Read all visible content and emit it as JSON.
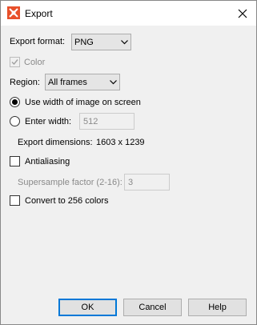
{
  "window": {
    "title": "Export",
    "close_glyph": "✕"
  },
  "export_format": {
    "label": "Export format:",
    "value": "PNG"
  },
  "color": {
    "label": "Color",
    "checked": true,
    "enabled": false
  },
  "region": {
    "label": "Region:",
    "value": "All frames"
  },
  "width_mode": {
    "use_screen_label": "Use width of image on screen",
    "enter_width_label": "Enter width:",
    "width_value": "512",
    "selected": "use_screen"
  },
  "export_dimensions": {
    "label": "Export dimensions:",
    "value": "1603 x 1239"
  },
  "antialiasing": {
    "label": "Antialiasing",
    "checked": false
  },
  "supersample": {
    "label": "Supersample factor (2-16):",
    "value": "3"
  },
  "convert_256": {
    "label": "Convert to 256 colors",
    "checked": false
  },
  "buttons": {
    "ok": "OK",
    "cancel": "Cancel",
    "help": "Help"
  },
  "colors": {
    "accent": "#0078d7",
    "disabled_text": "#8a8a8a",
    "icon_orange": "#e8502a"
  }
}
